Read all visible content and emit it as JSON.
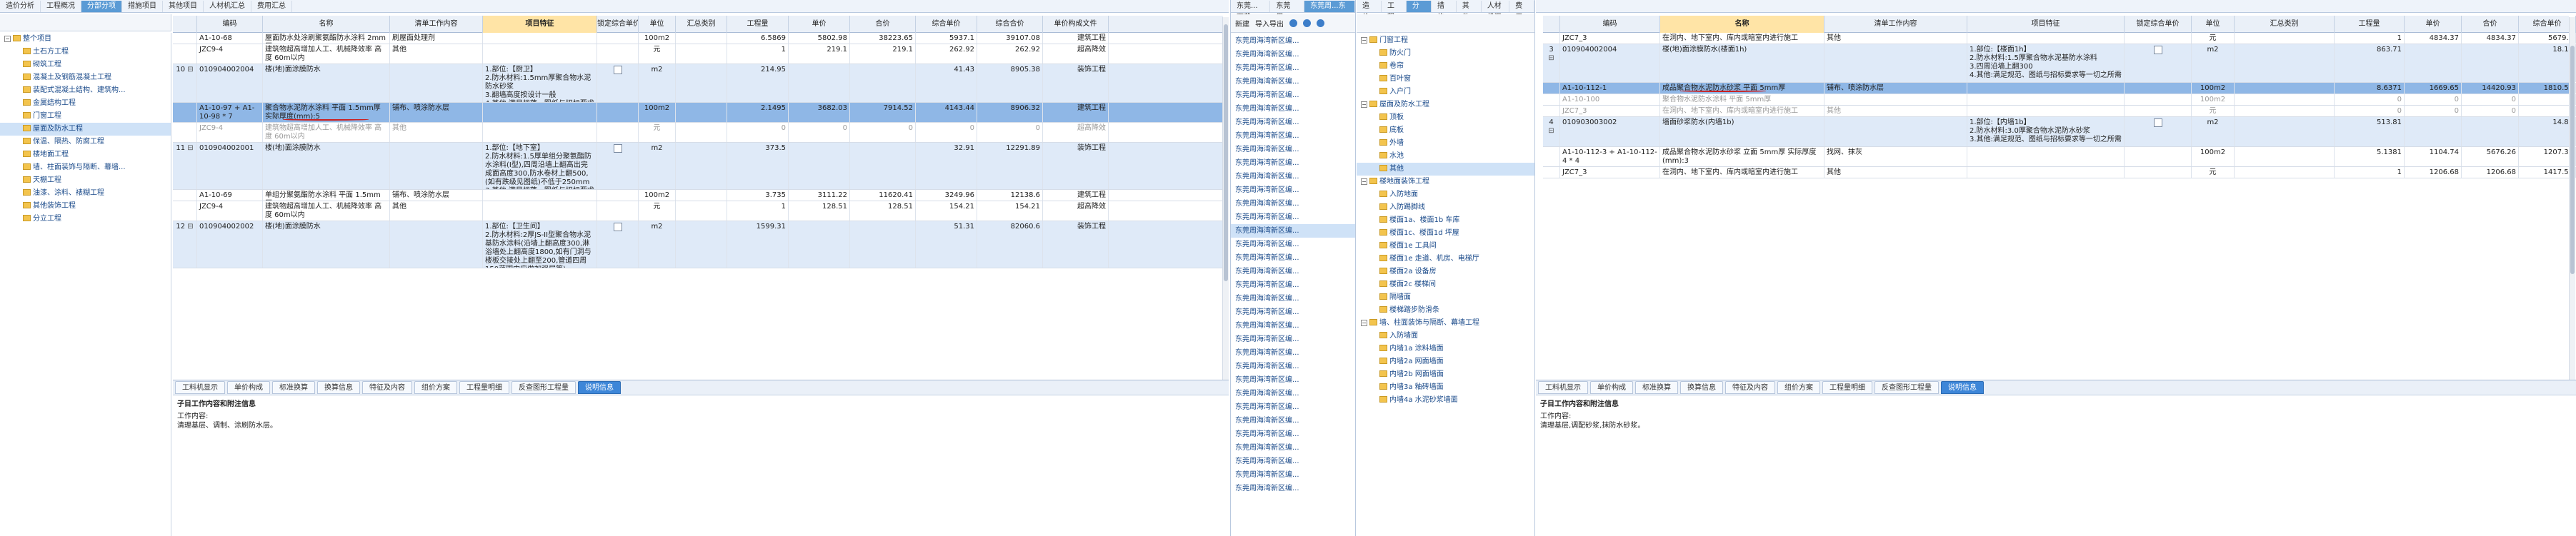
{
  "panel1": {
    "top_tabs": [
      "造价分析",
      "工程概况",
      "分部分项",
      "措施项目",
      "其他项目",
      "人材机汇总",
      "费用汇总"
    ],
    "active_tab": "分部分项",
    "tree": [
      {
        "label": "整个项目",
        "level": 0,
        "expanded": true
      },
      {
        "label": "土石方工程",
        "level": 1
      },
      {
        "label": "砌筑工程",
        "level": 1
      },
      {
        "label": "混凝土及钢筋混凝土工程",
        "level": 1
      },
      {
        "label": "装配式混凝土结构、建筑构...",
        "level": 1
      },
      {
        "label": "金属结构工程",
        "level": 1
      },
      {
        "label": "门窗工程",
        "level": 1
      },
      {
        "label": "屋面及防水工程",
        "level": 1,
        "selected": true
      },
      {
        "label": "保温、隔热、防腐工程",
        "level": 1
      },
      {
        "label": "楼地面工程",
        "level": 1
      },
      {
        "label": "墙、柱面装饰与隔断、幕墙...",
        "level": 1
      },
      {
        "label": "天棚工程",
        "level": 1
      },
      {
        "label": "油漆、涂料、裱糊工程",
        "level": 1
      },
      {
        "label": "其他装饰工程",
        "level": 1
      },
      {
        "label": "分立工程",
        "level": 1
      }
    ],
    "columns": [
      "",
      "编码",
      "名称",
      "清单工作内容",
      "项目特征",
      "锁定综合单价",
      "单位",
      "汇总类别",
      "工程量",
      "单价",
      "合价",
      "综合单价",
      "综合合价",
      "单价构成文件"
    ],
    "rows": [
      {
        "type": "sub",
        "no": "",
        "code": "A1-10-68",
        "name": "屋面防水处涂刷聚氨酯防水涂料 2mm厚",
        "work": "刷屋面处理剂",
        "feat": "",
        "lock": "",
        "unit": "100m2",
        "cat": "",
        "qty": "6.5869",
        "price": "5802.98",
        "amt": "38223.65",
        "cprice": "5937.1",
        "camt": "39107.08",
        "file": "建筑工程"
      },
      {
        "type": "sub",
        "no": "",
        "code": "JZC9-4",
        "name": "建筑物超高增加人工、机械降效率 高度 60m以内",
        "work": "其他",
        "feat": "",
        "lock": "",
        "unit": "元",
        "cat": "",
        "qty": "1",
        "price": "219.1",
        "amt": "219.1",
        "cprice": "262.92",
        "camt": "262.92",
        "file": "超高降效"
      },
      {
        "type": "main",
        "no": "10",
        "code": "010904002004",
        "name": "楼(地)面涂膜防水",
        "work": "",
        "feat": "1.部位:【厨卫】\n2.防水材料:1.5mm厚聚合物水泥防水砂浆\n3.翻墙高度按设计一般\n4.其他:满足规范、图纸与招标要求等一切之所需",
        "lock": "box",
        "unit": "m2",
        "cat": "",
        "qty": "214.95",
        "price": "",
        "amt": "",
        "cprice": "41.43",
        "camt": "8905.38",
        "file": "装饰工程"
      },
      {
        "type": "selected",
        "no": "",
        "code": "A1-10-97 + A1-10-98 * 7",
        "name": "聚合物水泥防水涂料 平面 1.5mm厚 实际厚度(mm):5",
        "work": "铺布、喷涂防水层",
        "feat": "",
        "lock": "",
        "unit": "100m2",
        "cat": "",
        "qty": "2.1495",
        "price": "3682.03",
        "amt": "7914.52",
        "cprice": "4143.44",
        "camt": "8906.32",
        "file": "建筑工程"
      },
      {
        "type": "strike",
        "no": "",
        "code": "JZC9-4",
        "name": "建筑物超高增加人工、机械降效率 高度 60m以内",
        "work": "其他",
        "feat": "",
        "lock": "",
        "unit": "元",
        "cat": "",
        "qty": "0",
        "price": "0",
        "amt": "0",
        "cprice": "0",
        "camt": "0",
        "file": "超高降效"
      },
      {
        "type": "main",
        "no": "11",
        "code": "010904002001",
        "name": "楼(地)面涂膜防水",
        "work": "",
        "feat": "1.部位:【地下室】\n2.防水材料:1.5厚单组分聚氨酯防水涂料(I型),四周沿墙上翻高出完成面高度300,防水卷材上翻500,(如有跌级见图纸)不低于250mm\n3.其他:满足规范、图纸与招标要求等一切之所需",
        "lock": "box",
        "unit": "m2",
        "cat": "",
        "qty": "373.5",
        "price": "",
        "amt": "",
        "cprice": "32.91",
        "camt": "12291.89",
        "file": "装饰工程"
      },
      {
        "type": "sub",
        "no": "",
        "code": "A1-10-69",
        "name": "单组分聚氨酯防水涂料 平面 1.5mm厚",
        "work": "铺布、喷涂防水层",
        "feat": "",
        "lock": "",
        "unit": "100m2",
        "cat": "",
        "qty": "3.735",
        "price": "3111.22",
        "amt": "11620.41",
        "cprice": "3249.96",
        "camt": "12138.6",
        "file": "建筑工程"
      },
      {
        "type": "sub",
        "no": "",
        "code": "JZC9-4",
        "name": "建筑物超高增加人工、机械降效率 高度 60m以内",
        "work": "其他",
        "feat": "",
        "lock": "",
        "unit": "元",
        "cat": "",
        "qty": "1",
        "price": "128.51",
        "amt": "128.51",
        "cprice": "154.21",
        "camt": "154.21",
        "file": "超高降效"
      },
      {
        "type": "main",
        "no": "12",
        "code": "010904002002",
        "name": "楼(地)面涂膜防水",
        "work": "",
        "feat": "1.部位:【卫生间】\n2.防水材料:2厚JS-II型聚合物水泥基防水涂料(沿墙上翻高度300,淋浴墙处上翻高度1800,如有门洞与楼板交接处上翻至200,管道四周150范围内应做加强层等)",
        "lock": "box",
        "unit": "m2",
        "cat": "",
        "qty": "1599.31",
        "price": "",
        "amt": "",
        "cprice": "51.31",
        "camt": "82060.6",
        "file": "装饰工程"
      }
    ],
    "bottom_tabs": [
      "工料机显示",
      "单价构成",
      "标准换算",
      "换算信息",
      "特征及内容",
      "组价方案",
      "工程量明细",
      "反查图形工程量",
      "说明信息"
    ],
    "active_bottom_tab": "说明信息",
    "desc_title": "子目工作内容和附注信息",
    "desc_body": "工作内容:\n清理基层、调制、涂刷防水层。"
  },
  "panel2": {
    "header": [
      "东莞...下载",
      "东莞周...",
      "东莞周...东工程"
    ],
    "toolbar": [
      "新建",
      "导入导出"
    ],
    "items": [
      "东莞周海湾新区编...",
      "东莞周海湾新区编...",
      "东莞周海湾新区编...",
      "东莞周海湾新区编...",
      "东莞周海湾新区编...",
      "东莞周海湾新区编...",
      "东莞周海湾新区编...",
      "东莞周海湾新区编...",
      "东莞周海湾新区编...",
      "东莞周海湾新区编...",
      "东莞周海湾新区编...",
      "东莞周海湾新区编...",
      "东莞周海湾新区编...",
      "东莞周海湾新区编...",
      "东莞周海湾新区编...",
      "东莞周海湾新区编...",
      "东莞周海湾新区编...",
      "东莞周海湾新区编...",
      "东莞周海湾新区编...",
      "东莞周海湾新区编...",
      "东莞周海湾新区编...",
      "东莞周海湾新区编...",
      "东莞周海湾新区编...",
      "东莞周海湾新区编...",
      "东莞周海湾新区编...",
      "东莞周海湾新区编...",
      "东莞周海湾新区编...",
      "东莞周海湾新区编...",
      "东莞周海湾新区编...",
      "东莞周海湾新区编...",
      "东莞周海湾新区编...",
      "东莞周海湾新区编...",
      "东莞周海湾新区编...",
      "东莞周海湾新区编..."
    ]
  },
  "panel3": {
    "top_tabs": [
      "造价分析",
      "工程概况",
      "分部分项",
      "措施项目",
      "其他项目",
      "人材机汇总",
      "费用汇总"
    ],
    "active_tab": "分部分项",
    "tree": [
      {
        "label": "门窗工程",
        "level": 0
      },
      {
        "label": "防火门",
        "level": 1
      },
      {
        "label": "卷帘",
        "level": 1
      },
      {
        "label": "百叶窗",
        "level": 1
      },
      {
        "label": "入户门",
        "level": 1
      },
      {
        "label": "屋面及防水工程",
        "level": 0
      },
      {
        "label": "顶板",
        "level": 1
      },
      {
        "label": "底板",
        "level": 1
      },
      {
        "label": "外墙",
        "level": 1
      },
      {
        "label": "水池",
        "level": 1
      },
      {
        "label": "其他",
        "level": 1,
        "selected": true
      },
      {
        "label": "楼地面装饰工程",
        "level": 0
      },
      {
        "label": "入防地面",
        "level": 1
      },
      {
        "label": "入防踢脚线",
        "level": 1
      },
      {
        "label": "楼面1a、楼面1b 车库",
        "level": 1
      },
      {
        "label": "楼面1c、楼面1d 坪屋",
        "level": 1
      },
      {
        "label": "楼面1e 工具间",
        "level": 1
      },
      {
        "label": "楼面1e 走道、机房、电梯厅",
        "level": 1
      },
      {
        "label": "楼面2a 设备房",
        "level": 1
      },
      {
        "label": "楼面2c 楼梯间",
        "level": 1
      },
      {
        "label": "隔墙面",
        "level": 1
      },
      {
        "label": "楼梯踏步防滑条",
        "level": 1
      },
      {
        "label": "墙、柱面装饰与隔断、幕墙工程",
        "level": 0
      },
      {
        "label": "入防墙面",
        "level": 1
      },
      {
        "label": "内墙1a 涂料墙面",
        "level": 1
      },
      {
        "label": "内墙2a 网面墙面",
        "level": 1
      },
      {
        "label": "内墙2b 网面墙面",
        "level": 1
      },
      {
        "label": "内墙3a 釉砖墙面",
        "level": 1
      },
      {
        "label": "内墙4a 水泥砂浆墙面",
        "level": 1
      }
    ]
  },
  "panel4": {
    "columns": [
      "",
      "编码",
      "名称",
      "清单工作内容",
      "项目特征",
      "锁定综合单价",
      "单位",
      "汇总类别",
      "工程量",
      "单价",
      "合价",
      "综合单价",
      "综合合价"
    ],
    "rows": [
      {
        "type": "sub",
        "no": "",
        "code": "JZC7_3",
        "name": "在洞内、地下室内、库内或暗室内进行施工",
        "work": "其他",
        "feat": "",
        "lock": "",
        "unit": "元",
        "cat": "",
        "qty": "1",
        "price": "4834.37",
        "amt": "4834.37",
        "cprice": "5679.1",
        "camt": "5679.1"
      },
      {
        "type": "main",
        "no": "3",
        "code": "010904002004",
        "name": "楼(地)面涂膜防水(楼面1h)",
        "work": "",
        "feat": "1.部位:【楼面1h】\n2.防水材料:1.5厚聚合物水泥基防水涂料\n3.四周沿墙上翻300\n4.其他:满足规范、图纸与招标要求等一切之所需",
        "lock": "box",
        "unit": "m2",
        "cat": "",
        "qty": "863.71",
        "price": "",
        "amt": "",
        "cprice": "18.11",
        "camt": "15641.79"
      },
      {
        "type": "selected",
        "no": "",
        "code": "A1-10-112-1",
        "name": "成品聚合物水泥防水砂浆 平面 5mm厚",
        "work": "铺布、喷涂防水层",
        "feat": "",
        "lock": "",
        "unit": "100m2",
        "cat": "",
        "qty": "8.6371",
        "price": "1669.65",
        "amt": "14420.93",
        "cprice": "1810.57",
        "camt": "15638.07"
      },
      {
        "type": "strike",
        "no": "",
        "code": "A1-10-100",
        "name": "聚合物水泥防水涂料 平面 5mm厚",
        "work": "",
        "feat": "",
        "lock": "",
        "unit": "100m2",
        "cat": "",
        "qty": "0",
        "price": "0",
        "amt": "0",
        "cprice": "0",
        "camt": "0"
      },
      {
        "type": "strike",
        "no": "",
        "code": "JZC7_3",
        "name": "在洞内、地下室内、库内或暗室内进行施工",
        "work": "其他",
        "feat": "",
        "lock": "",
        "unit": "元",
        "cat": "",
        "qty": "0",
        "price": "0",
        "amt": "0",
        "cprice": "0",
        "camt": "0"
      },
      {
        "type": "main",
        "no": "4",
        "code": "010903003002",
        "name": "墙面砂浆防水(内墙1b)",
        "work": "",
        "feat": "1.部位:【内墙1b】\n2.防水材料:3.0厚聚合物水泥防水砂浆\n3.其他:满足规范、图纸与招标要求等一切之所需",
        "lock": "box",
        "unit": "m2",
        "cat": "",
        "qty": "513.81",
        "price": "",
        "amt": "",
        "cprice": "14.83",
        "camt": "7619.8"
      },
      {
        "type": "sub",
        "no": "",
        "code": "A1-10-112-3 + A1-10-112-4 * 4",
        "name": "成品聚合物水泥防水砂浆 立面 5mm厚 实际厚度(mm):3",
        "work": "找网、抹灰",
        "feat": "",
        "lock": "",
        "unit": "100m2",
        "cat": "",
        "qty": "5.1381",
        "price": "1104.74",
        "amt": "5676.26",
        "cprice": "1207.33",
        "camt": "6203.39"
      },
      {
        "type": "sub",
        "no": "",
        "code": "JZC7_3",
        "name": "在洞内、地下室内、库内或暗室内进行施工",
        "work": "其他",
        "feat": "",
        "lock": "",
        "unit": "元",
        "cat": "",
        "qty": "1",
        "price": "1206.68",
        "amt": "1206.68",
        "cprice": "1417.53",
        "camt": "1417.53"
      }
    ],
    "bottom_tabs": [
      "工料机显示",
      "单价构成",
      "标准换算",
      "换算信息",
      "特征及内容",
      "组价方案",
      "工程量明细",
      "反查图形工程量",
      "说明信息"
    ],
    "active_bottom_tab": "说明信息",
    "desc_title": "子目工作内容和附注信息",
    "desc_body": "工作内容:\n清理基层,调配砂浆,抹防水砂浆。"
  }
}
